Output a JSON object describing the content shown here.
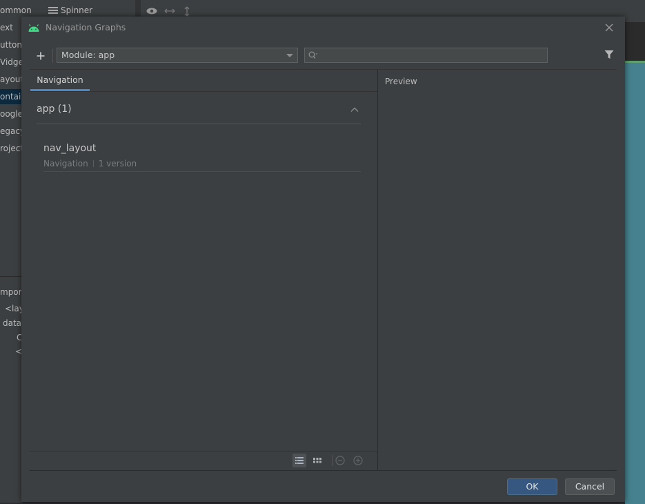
{
  "background": {
    "palette_categories": [
      "ommon",
      "ext",
      "uttons",
      "Vidgets",
      "ayouts",
      "ontain",
      "oogle",
      "egacy",
      "roject"
    ],
    "selected_category": "ontain",
    "spinner_label": "Spinner",
    "tree_rows": [
      "mpone",
      "<lay",
      "data",
      "C",
      "<"
    ]
  },
  "dialog": {
    "title": "Navigation Graphs",
    "toolbar": {
      "module_select_value": "Module: app",
      "search_placeholder": ""
    },
    "tabs": [
      {
        "label": "Navigation",
        "active": true
      }
    ],
    "group": {
      "title": "app (1)",
      "expanded": true
    },
    "items": [
      {
        "name": "nav_layout",
        "type": "Navigation",
        "versions": "1 version"
      }
    ],
    "preview_label": "Preview",
    "buttons": {
      "ok": "OK",
      "cancel": "Cancel"
    }
  },
  "colors": {
    "accent": "#4a88c7",
    "dialog_bg": "#3c3f41",
    "ok_button": "#365880",
    "android_green": "#3ddc84",
    "design_surface": "#45818e"
  }
}
